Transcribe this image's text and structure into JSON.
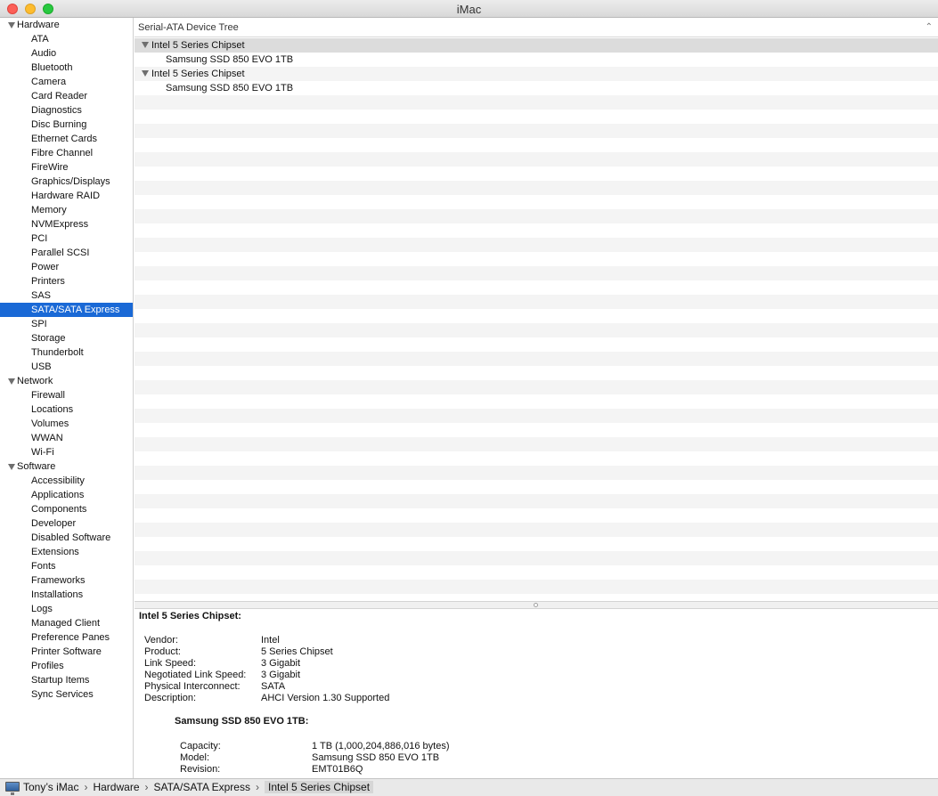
{
  "window": {
    "title": "iMac"
  },
  "sidebar": {
    "selected": "SATA/SATA Express",
    "sections": [
      {
        "label": "Hardware",
        "items": [
          "ATA",
          "Audio",
          "Bluetooth",
          "Camera",
          "Card Reader",
          "Diagnostics",
          "Disc Burning",
          "Ethernet Cards",
          "Fibre Channel",
          "FireWire",
          "Graphics/Displays",
          "Hardware RAID",
          "Memory",
          "NVMExpress",
          "PCI",
          "Parallel SCSI",
          "Power",
          "Printers",
          "SAS",
          "SATA/SATA Express",
          "SPI",
          "Storage",
          "Thunderbolt",
          "USB"
        ]
      },
      {
        "label": "Network",
        "items": [
          "Firewall",
          "Locations",
          "Volumes",
          "WWAN",
          "Wi-Fi"
        ]
      },
      {
        "label": "Software",
        "items": [
          "Accessibility",
          "Applications",
          "Components",
          "Developer",
          "Disabled Software",
          "Extensions",
          "Fonts",
          "Frameworks",
          "Installations",
          "Logs",
          "Managed Client",
          "Preference Panes",
          "Printer Software",
          "Profiles",
          "Startup Items",
          "Sync Services"
        ]
      }
    ]
  },
  "tree": {
    "header": "Serial-ATA Device Tree",
    "rows": [
      {
        "label": "Intel 5 Series Chipset",
        "level": 0,
        "selected": true
      },
      {
        "label": "Samsung SSD 850 EVO 1TB",
        "level": 1,
        "selected": false
      },
      {
        "label": "Intel 5 Series Chipset",
        "level": 0,
        "selected": false
      },
      {
        "label": "Samsung SSD 850 EVO 1TB",
        "level": 1,
        "selected": false
      }
    ]
  },
  "detail": {
    "heading": "Intel 5 Series Chipset:",
    "fields": [
      {
        "key": "Vendor:",
        "value": "Intel"
      },
      {
        "key": "Product:",
        "value": "5 Series Chipset"
      },
      {
        "key": "Link Speed:",
        "value": "3 Gigabit"
      },
      {
        "key": "Negotiated Link Speed:",
        "value": "3 Gigabit"
      },
      {
        "key": "Physical Interconnect:",
        "value": "SATA"
      },
      {
        "key": "Description:",
        "value": "AHCI Version 1.30 Supported"
      }
    ],
    "device": {
      "heading": "Samsung SSD 850 EVO 1TB:",
      "fields": [
        {
          "key": "Capacity:",
          "value": "1 TB (1,000,204,886,016 bytes)"
        },
        {
          "key": "Model:",
          "value": "Samsung SSD 850 EVO 1TB"
        },
        {
          "key": "Revision:",
          "value": "EMT01B6Q"
        }
      ]
    }
  },
  "pathbar": {
    "icon": "imac-icon",
    "crumbs": [
      "Tony’s iMac",
      "Hardware",
      "SATA/SATA Express",
      "Intel 5 Series Chipset"
    ],
    "separator": "›"
  },
  "colors": {
    "selection": "#1a69d6"
  }
}
